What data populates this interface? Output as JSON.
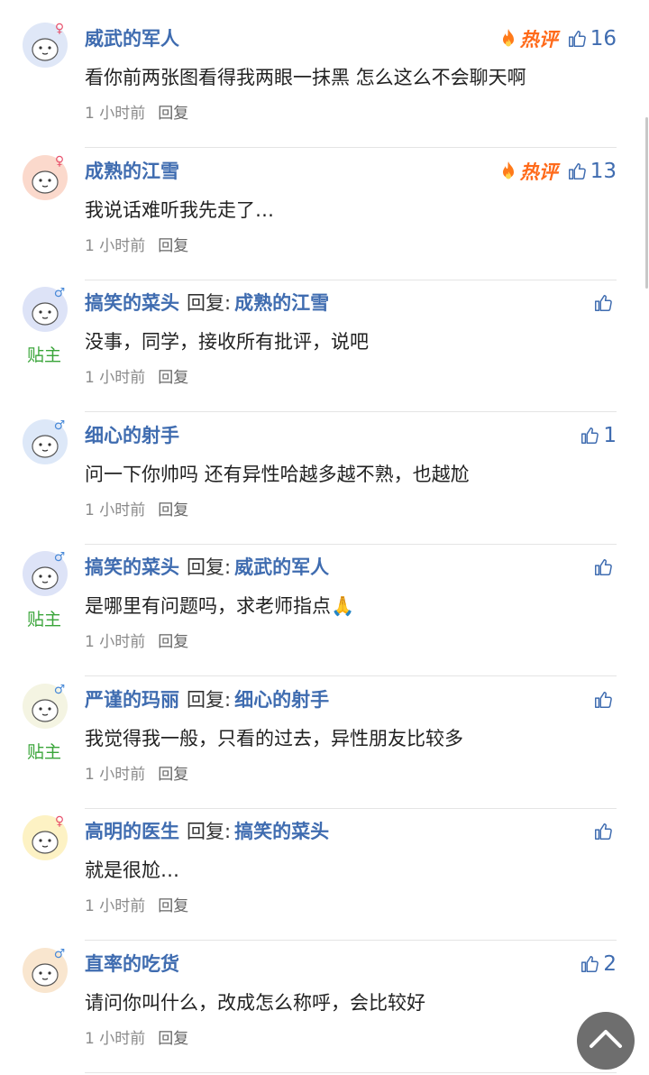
{
  "ui": {
    "hot_label": "热评",
    "reply_word": "回复:",
    "op_badge": "贴主",
    "reply_button": "回复"
  },
  "colors": {
    "name": "#3f6cb0",
    "hot": "#ff6a1a",
    "op_badge": "#3aa53a",
    "meta": "#8a8a8a"
  },
  "comments": [
    {
      "name": "威武的军人",
      "gender": "female",
      "gender_symbol": "♀",
      "avatar_bg": "#dfe7f7",
      "reply_to": "",
      "is_op": false,
      "hot": true,
      "likes": "16",
      "text": "看你前两张图看得我两眼一抹黑 怎么这么不会聊天啊",
      "time": "1 小时前"
    },
    {
      "name": "成熟的江雪",
      "gender": "female",
      "gender_symbol": "♀",
      "avatar_bg": "#fbd9cc",
      "reply_to": "",
      "is_op": false,
      "hot": true,
      "likes": "13",
      "text": "我说话难听我先走了…",
      "time": "1 小时前"
    },
    {
      "name": "搞笑的菜头",
      "gender": "male",
      "gender_symbol": "♂",
      "avatar_bg": "#dde3f7",
      "reply_to": "成熟的江雪",
      "is_op": true,
      "hot": false,
      "likes": "",
      "text": "没事，同学，接收所有批评，说吧",
      "time": "1 小时前"
    },
    {
      "name": "细心的射手",
      "gender": "male",
      "gender_symbol": "♂",
      "avatar_bg": "#dde8f8",
      "reply_to": "",
      "is_op": false,
      "hot": false,
      "likes": "1",
      "text": "问一下你帅吗 还有异性哈越多越不熟，也越尬",
      "time": "1 小时前"
    },
    {
      "name": "搞笑的菜头",
      "gender": "male",
      "gender_symbol": "♂",
      "avatar_bg": "#dde3f7",
      "reply_to": "威武的军人",
      "is_op": true,
      "hot": false,
      "likes": "",
      "text": "是哪里有问题吗，求老师指点🙏",
      "time": "1 小时前"
    },
    {
      "name": "严谨的玛丽",
      "gender": "male",
      "gender_symbol": "♂",
      "avatar_bg": "#f4f4e2",
      "reply_to": "细心的射手",
      "is_op": true,
      "hot": false,
      "likes": "",
      "text": "我觉得我一般，只看的过去，异性朋友比较多",
      "time": "1 小时前"
    },
    {
      "name": "高明的医生",
      "gender": "female",
      "gender_symbol": "♀",
      "avatar_bg": "#fdf2c4",
      "reply_to": "搞笑的菜头",
      "is_op": false,
      "hot": false,
      "likes": "",
      "text": "就是很尬…",
      "time": "1 小时前"
    },
    {
      "name": "直率的吃货",
      "gender": "male",
      "gender_symbol": "♂",
      "avatar_bg": "#f9e6cf",
      "reply_to": "",
      "is_op": false,
      "hot": false,
      "likes": "2",
      "text": "请问你叫什么，改成怎么称呼，会比较好",
      "time": "1 小时前"
    }
  ]
}
